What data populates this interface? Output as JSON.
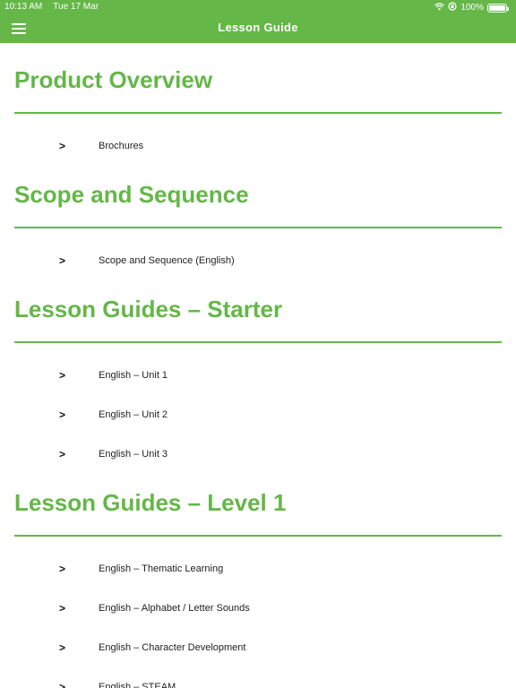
{
  "status": {
    "time": "10:13 AM",
    "date": "Tue 17 Mar",
    "battery": "100%"
  },
  "header": {
    "title": "Lesson Guide"
  },
  "chevron": ">",
  "sections": [
    {
      "title": "Product Overview",
      "items": [
        "Brochures"
      ]
    },
    {
      "title": "Scope and Sequence",
      "items": [
        "Scope and Sequence (English)"
      ]
    },
    {
      "title": "Lesson Guides – Starter",
      "items": [
        "English – Unit 1",
        "English – Unit 2",
        "English – Unit 3"
      ]
    },
    {
      "title": "Lesson Guides – Level 1",
      "items": [
        "English – Thematic Learning",
        "English – Alphabet / Letter Sounds",
        "English – Character Development",
        "English – STEAM"
      ]
    }
  ],
  "colors": {
    "accent": "#65b748"
  }
}
